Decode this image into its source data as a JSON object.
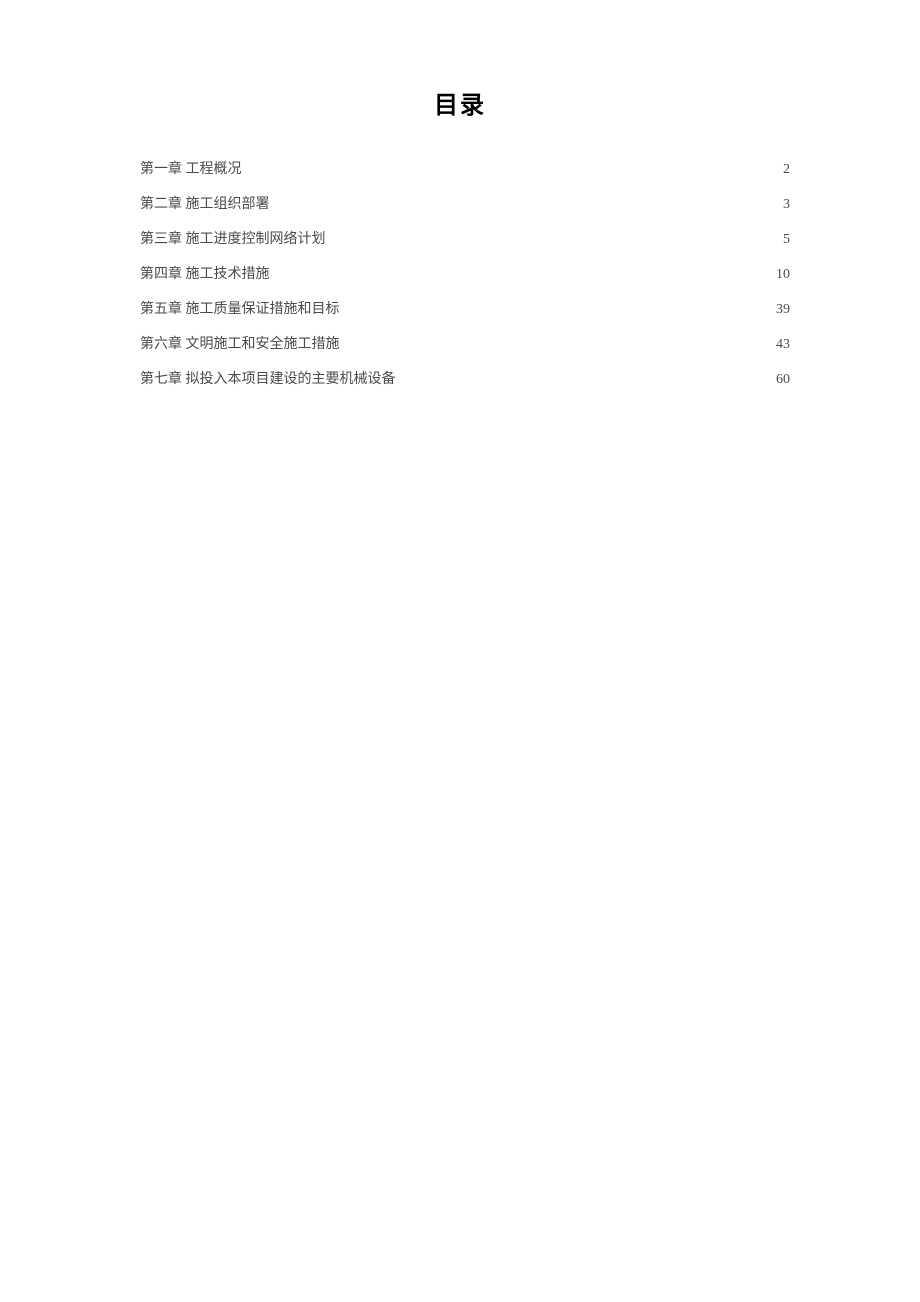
{
  "title": "目录",
  "toc": [
    {
      "label": "第一章 工程概况",
      "page": "2"
    },
    {
      "label": "第二章 施工组织部署",
      "page": "3"
    },
    {
      "label": "第三章 施工进度控制网络计划",
      "page": "5"
    },
    {
      "label": "第四章 施工技术措施",
      "page": "10"
    },
    {
      "label": "第五章 施工质量保证措施和目标",
      "page": "39"
    },
    {
      "label": "第六章 文明施工和安全施工措施",
      "page": "43"
    },
    {
      "label": "第七章 拟投入本项目建设的主要机械设备",
      "page": "60"
    }
  ]
}
